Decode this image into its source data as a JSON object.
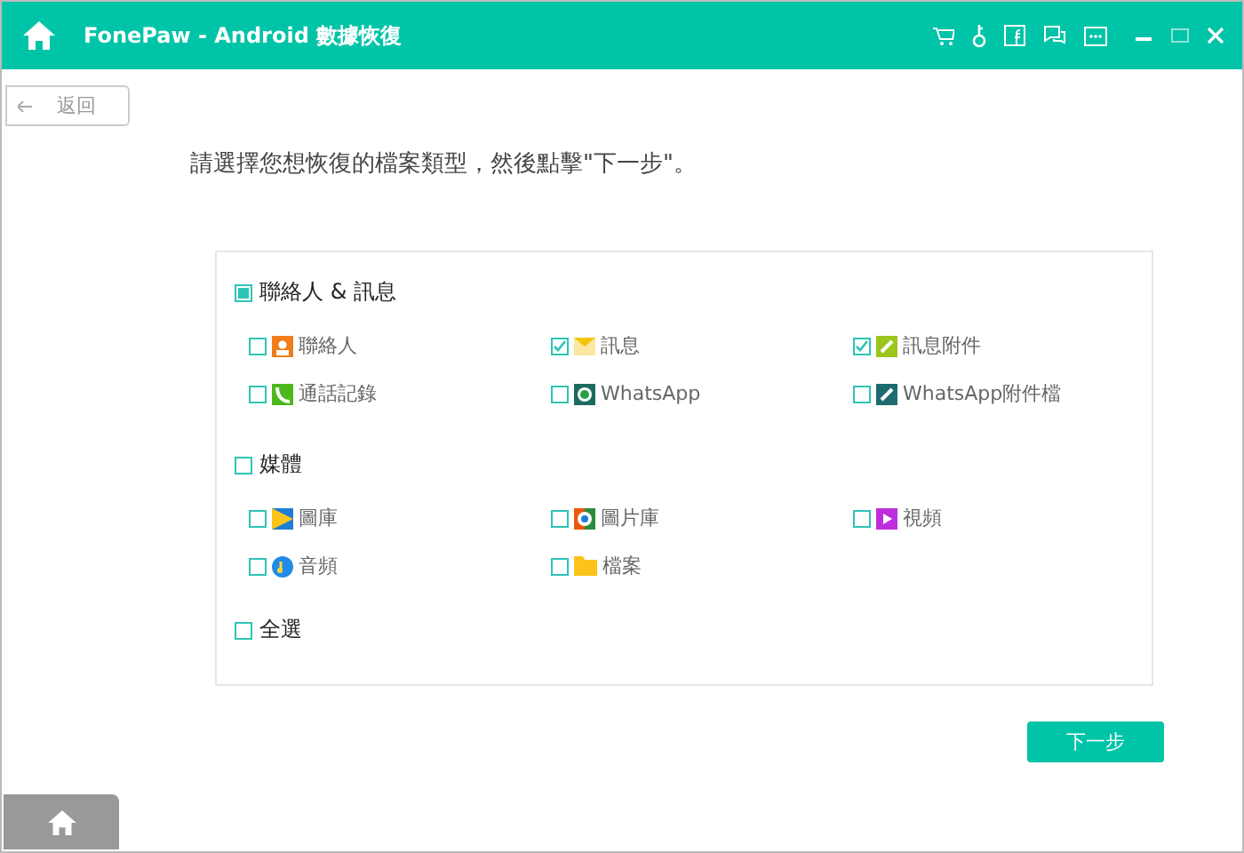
{
  "window": {
    "title": "FonePaw - Android 數據恢復"
  },
  "back_button": "返回",
  "instruction": "請選擇您想恢復的檔案類型，然後點擊\"下一步\"。",
  "groups": [
    {
      "label": "聯絡人 & 訊息",
      "checked": false,
      "partial": true,
      "items": [
        {
          "label": "聯絡人",
          "checked": false,
          "kind": "contact"
        },
        {
          "label": "訊息",
          "checked": true,
          "kind": "message"
        },
        {
          "label": "訊息附件",
          "checked": true,
          "kind": "attachment"
        },
        {
          "label": "通話記錄",
          "checked": false,
          "kind": "phone"
        },
        {
          "label": "WhatsApp",
          "checked": false,
          "kind": "whatsapp"
        },
        {
          "label": "WhatsApp附件檔",
          "checked": false,
          "kind": "clip"
        }
      ]
    },
    {
      "label": "媒體",
      "checked": false,
      "partial": false,
      "items": [
        {
          "label": "圖庫",
          "checked": false,
          "kind": "gallery"
        },
        {
          "label": "圖片庫",
          "checked": false,
          "kind": "pictures"
        },
        {
          "label": "視頻",
          "checked": false,
          "kind": "video"
        },
        {
          "label": "音頻",
          "checked": false,
          "kind": "audio"
        },
        {
          "label": "檔案",
          "checked": false,
          "kind": "folder"
        }
      ]
    }
  ],
  "select_all": {
    "label": "全選",
    "checked": false
  },
  "next_button": "下一步"
}
